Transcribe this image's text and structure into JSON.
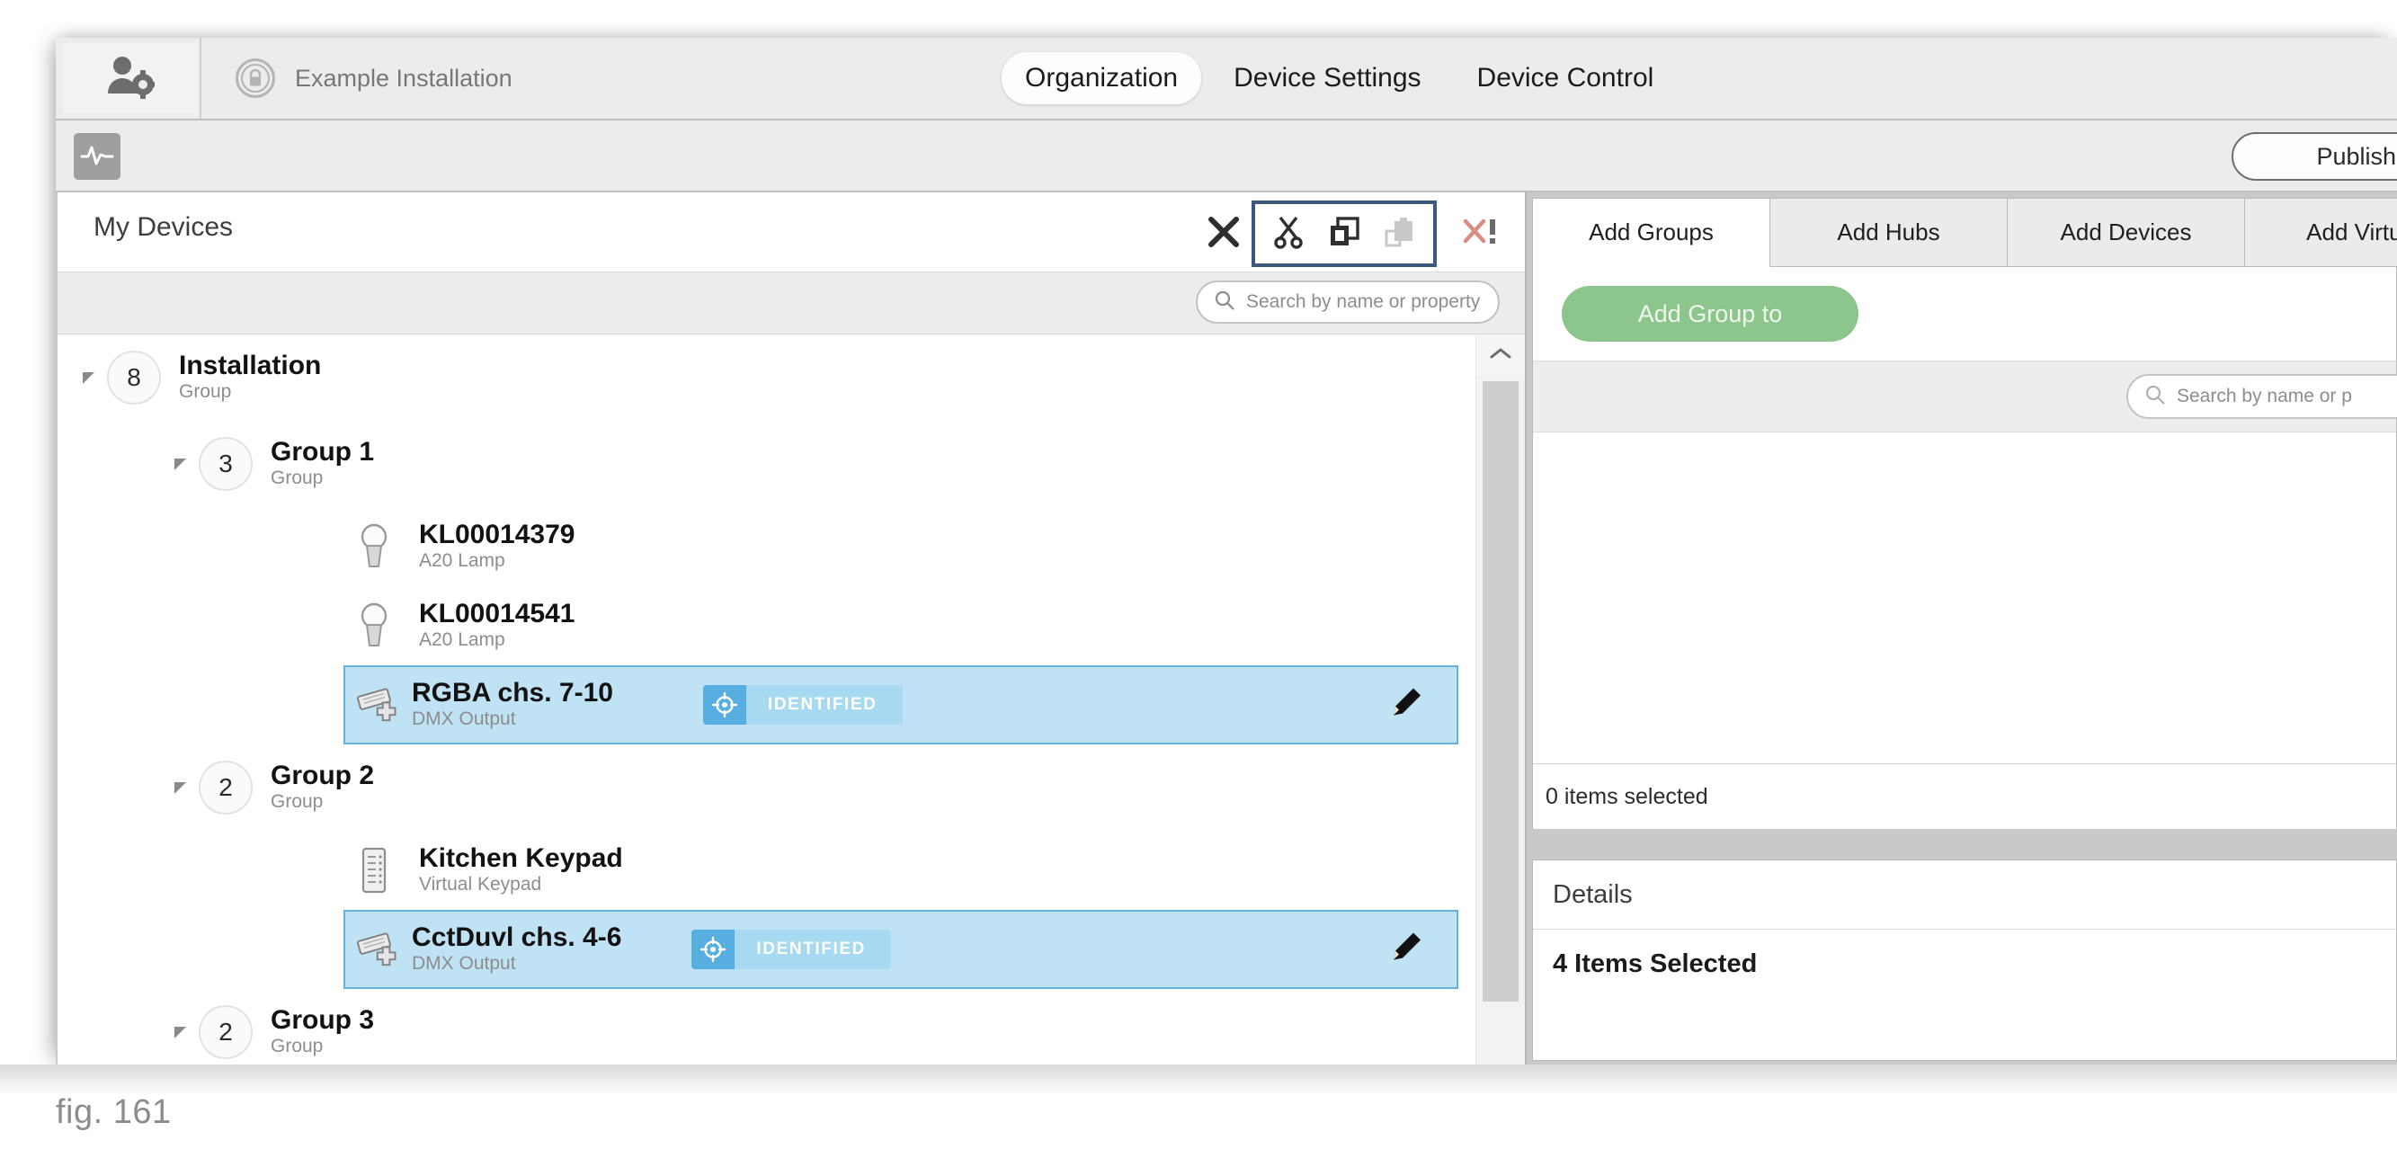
{
  "topbar": {
    "user_settings_icon": "user-gear-icon",
    "lock_icon": "lock-badge-icon",
    "installation_name": "Example Installation",
    "tabs": [
      {
        "label": "Organization",
        "active": true
      },
      {
        "label": "Device Settings",
        "active": false
      },
      {
        "label": "Device Control",
        "active": false
      }
    ]
  },
  "subbar": {
    "activity_icon": "pulse-icon",
    "publish_label": "Publish and"
  },
  "devices_panel": {
    "title": "My Devices",
    "tools": [
      {
        "name": "delete-icon",
        "glyph": "✕",
        "enabled": true
      },
      {
        "name": "cut-icon",
        "glyph": "✂",
        "enabled": true
      },
      {
        "name": "copy-icon",
        "glyph": "⧉",
        "enabled": true
      },
      {
        "name": "paste-icon",
        "glyph": "⧉",
        "enabled": false
      },
      {
        "name": "clear-errors-icon",
        "glyph": "✕!",
        "enabled": true
      }
    ],
    "search": {
      "placeholder": "Search by name or property",
      "value": ""
    },
    "tree": [
      {
        "kind": "group",
        "count": "8",
        "title": "Installation",
        "subtitle": "Group",
        "indent": 0,
        "expanded": true
      },
      {
        "kind": "group",
        "count": "3",
        "title": "Group 1",
        "subtitle": "Group",
        "indent": 1,
        "expanded": true
      },
      {
        "kind": "device",
        "icon": "lamp-icon",
        "title": "KL00014379",
        "subtitle": "A20 Lamp",
        "indent": 2,
        "selected": false,
        "badge": null,
        "editable": false
      },
      {
        "kind": "device",
        "icon": "lamp-icon",
        "title": "KL00014541",
        "subtitle": "A20 Lamp",
        "indent": 2,
        "selected": false,
        "badge": null,
        "editable": false
      },
      {
        "kind": "device",
        "icon": "dmx-add-icon",
        "title": "RGBA chs. 7-10",
        "subtitle": "DMX Output",
        "indent": 2,
        "selected": true,
        "badge": "IDENTIFIED",
        "editable": true
      },
      {
        "kind": "group",
        "count": "2",
        "title": "Group 2",
        "subtitle": "Group",
        "indent": 1,
        "expanded": true
      },
      {
        "kind": "device",
        "icon": "keypad-icon",
        "title": "Kitchen Keypad",
        "subtitle": "Virtual Keypad",
        "indent": 2,
        "selected": false,
        "badge": null,
        "editable": false
      },
      {
        "kind": "device",
        "icon": "dmx-add-icon",
        "title": "CctDuvl chs. 4-6",
        "subtitle": "DMX Output",
        "indent": 2,
        "selected": true,
        "badge": "IDENTIFIED",
        "editable": true
      },
      {
        "kind": "group",
        "count": "2",
        "title": "Group 3",
        "subtitle": "Group",
        "indent": 1,
        "expanded": true
      }
    ],
    "scrollbar": {
      "up_icon": "chevron-up-icon"
    }
  },
  "right_panel": {
    "tabs": [
      {
        "label": "Add Groups",
        "active": true
      },
      {
        "label": "Add Hubs",
        "active": false
      },
      {
        "label": "Add Devices",
        "active": false
      },
      {
        "label": "Add Virtual",
        "active": false
      }
    ],
    "add_group_label": "Add Group to",
    "search": {
      "placeholder": "Search by name or p",
      "value": ""
    },
    "status": "0 items selected",
    "details": {
      "header": "Details",
      "selection": "4 Items Selected"
    }
  },
  "caption": "fig. 161",
  "colors": {
    "accent_blue": "#3b5a80",
    "selection_fill": "#bfe2f5",
    "selection_border": "#63b3dd",
    "badge_icon_bg": "#57aee0",
    "badge_bg": "#a7d9f0",
    "add_button_green": "#8cc68c",
    "window_chrome": "#ececec"
  }
}
